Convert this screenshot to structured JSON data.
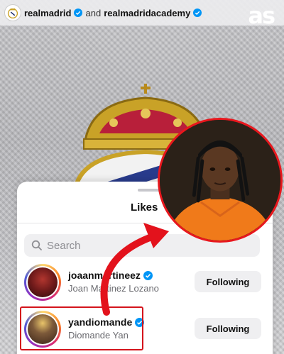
{
  "post_header": {
    "account_1": "realmadrid",
    "conjunction": "and",
    "account_2": "realmadridacademy"
  },
  "brand_logo": "as",
  "likes_sheet": {
    "title": "Likes",
    "search": {
      "placeholder": "Search",
      "value": ""
    },
    "users": [
      {
        "username": "joaanmartineez",
        "full_name": "Joan Martinez Lozano",
        "verified": true,
        "button_label": "Following"
      },
      {
        "username": "yandiomande",
        "full_name": "Diomande Yan",
        "verified": true,
        "button_label": "Following"
      }
    ]
  },
  "colors": {
    "highlight_red": "#d4141c",
    "verified_blue": "#0095f6",
    "button_bg": "#efeff1"
  }
}
